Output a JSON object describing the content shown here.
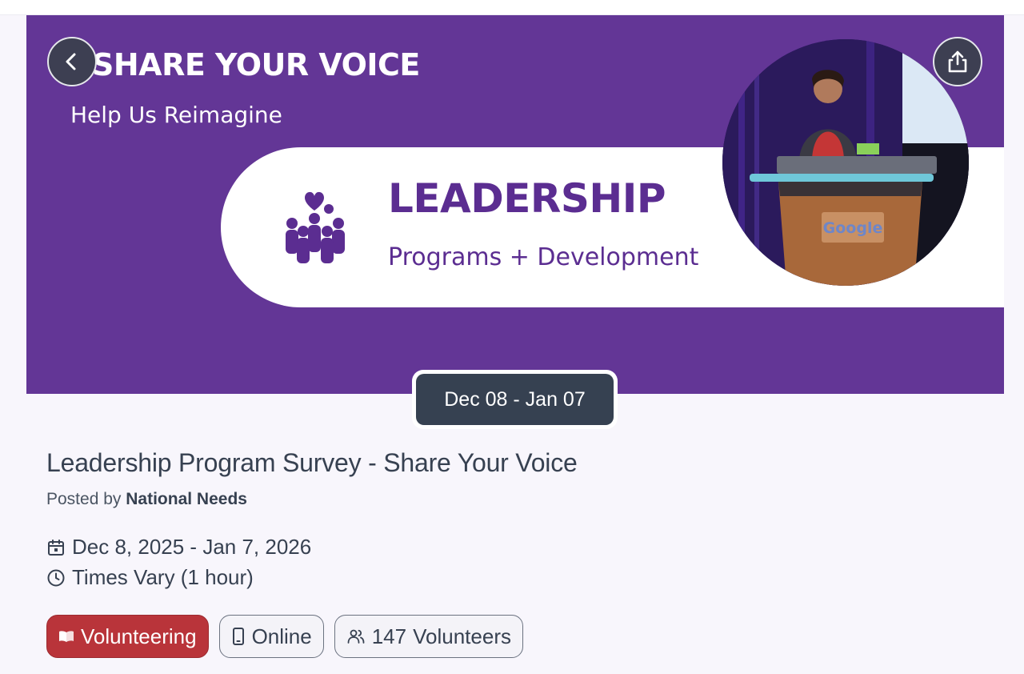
{
  "hero": {
    "title": "SHARE YOUR VOICE",
    "subtitle": "Help Us Reimagine",
    "banner_title": "LEADERSHIP",
    "banner_subtitle": "Programs + Development",
    "photo_sign": "Google",
    "brand_color": "#633696"
  },
  "nav": {
    "back_icon": "chevron-left-icon",
    "share_icon": "share-icon"
  },
  "date_badge": "Dec 08 - Jan 07",
  "event": {
    "title": "Leadership Program Survey - Share Your Voice",
    "posted_prefix": "Posted by",
    "organizer": "National Needs",
    "date_range": "Dec 8, 2025 - Jan 7, 2026",
    "time": "Times Vary (1 hour)"
  },
  "tags": {
    "category": "Volunteering",
    "location": "Online",
    "volunteers_count": "147",
    "volunteers_label": "Volunteers",
    "accent_color": "#b9343a"
  }
}
